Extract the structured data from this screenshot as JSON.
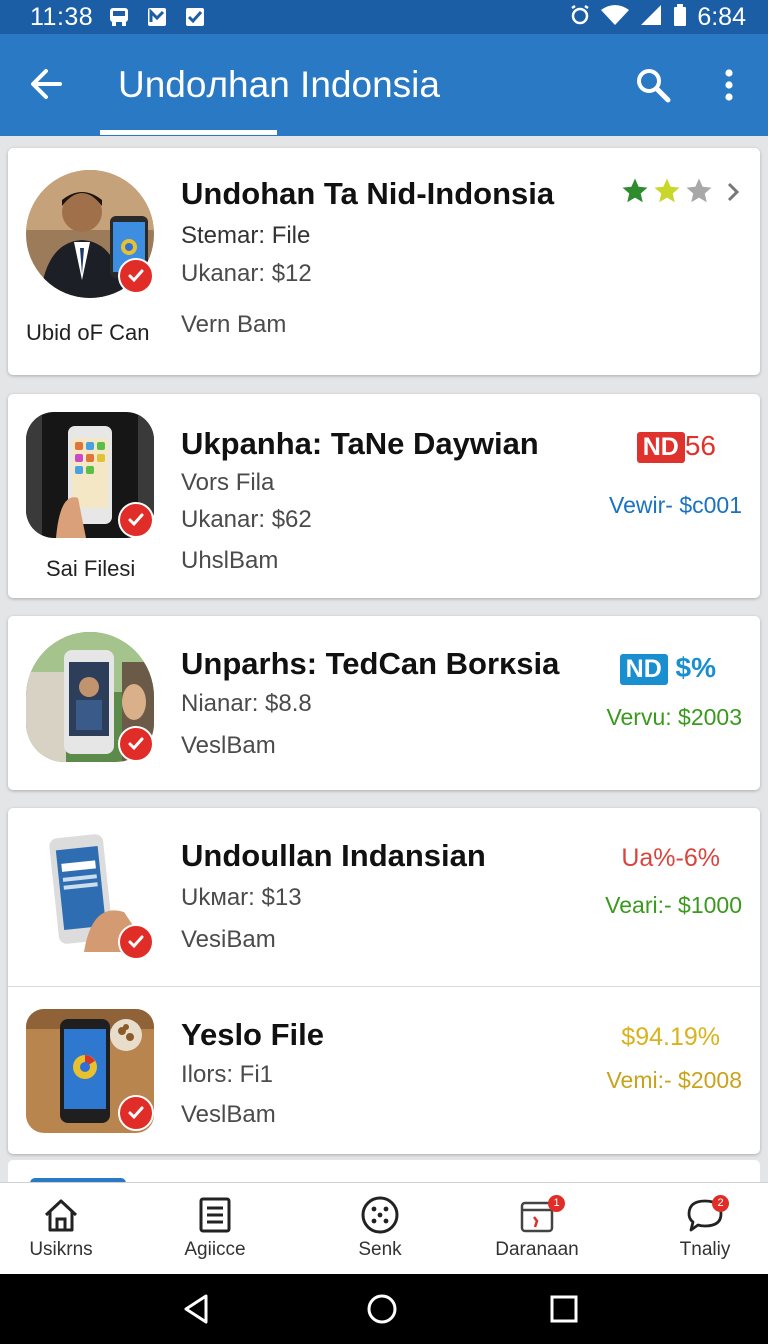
{
  "status_bar": {
    "time": "11:38",
    "right_time": "6:84",
    "icons": [
      "bus-icon",
      "notification-icon",
      "check-box-icon",
      "alarm-icon",
      "wifi-icon",
      "signal-icon",
      "battery-icon"
    ]
  },
  "app_bar": {
    "title": "Undoлhan Indonsia"
  },
  "items": [
    {
      "title": "Undohan Ta Nid-Indonsia",
      "line1": "Stemar: File",
      "line2": "Ukanar: $12",
      "line3": "Vern Bam",
      "caption": "Ubid oF Can",
      "rating": 2,
      "rating_max": 3
    },
    {
      "title": "Ukpanha: TaNe Daywian",
      "line1": "Vors Fila",
      "line2": "Ukanar: $62",
      "line3": "UhslBam",
      "caption": "Sai Filesi",
      "badge": "ND",
      "badge_value": "56",
      "version": "Vewir- $c001",
      "accent": "#e0322c",
      "version_color": "#1a72c2"
    },
    {
      "title": "Unparhs: TedCan Borĸsia",
      "line1": "Nianar: $8.8",
      "line2": "VeslBam",
      "badge": "ND",
      "badge_value": "$%",
      "version": "Vervu: $2003",
      "accent": "#1a8fd0",
      "version_color": "#3a9a1e"
    },
    {
      "title": "Undoullan Indansian",
      "line1": "Ukмar: $13",
      "line2": "VesiBam",
      "price": "Ua%-6%",
      "version": "Veari:- $1000",
      "accent": "#d9453d",
      "version_color": "#3a9a1e"
    },
    {
      "title": "Yeslo File",
      "line1": "Ilors: Fi1",
      "line2": "VeslBam",
      "price": "$94.19%",
      "version": "Vemi:- $2008",
      "accent": "#d9b21c",
      "version_color": "#3a9a1e"
    }
  ],
  "bottom_nav": [
    {
      "label": "Usikrns",
      "icon": "home-icon"
    },
    {
      "label": "Agiicce",
      "icon": "document-icon"
    },
    {
      "label": "Senk",
      "icon": "dots-circle-icon"
    },
    {
      "label": "Daranaan",
      "icon": "calendar-icon",
      "badge": "1"
    },
    {
      "label": "Tnaliy",
      "icon": "chat-icon",
      "badge": "2"
    }
  ],
  "colors": {
    "app_bar": "#2979c4",
    "status_bar": "#1c5ea6",
    "check": "#e02d28",
    "star_filled": "#2e8b2e",
    "star_yellow": "#c9d62a",
    "star_empty": "#a8a8a8"
  }
}
